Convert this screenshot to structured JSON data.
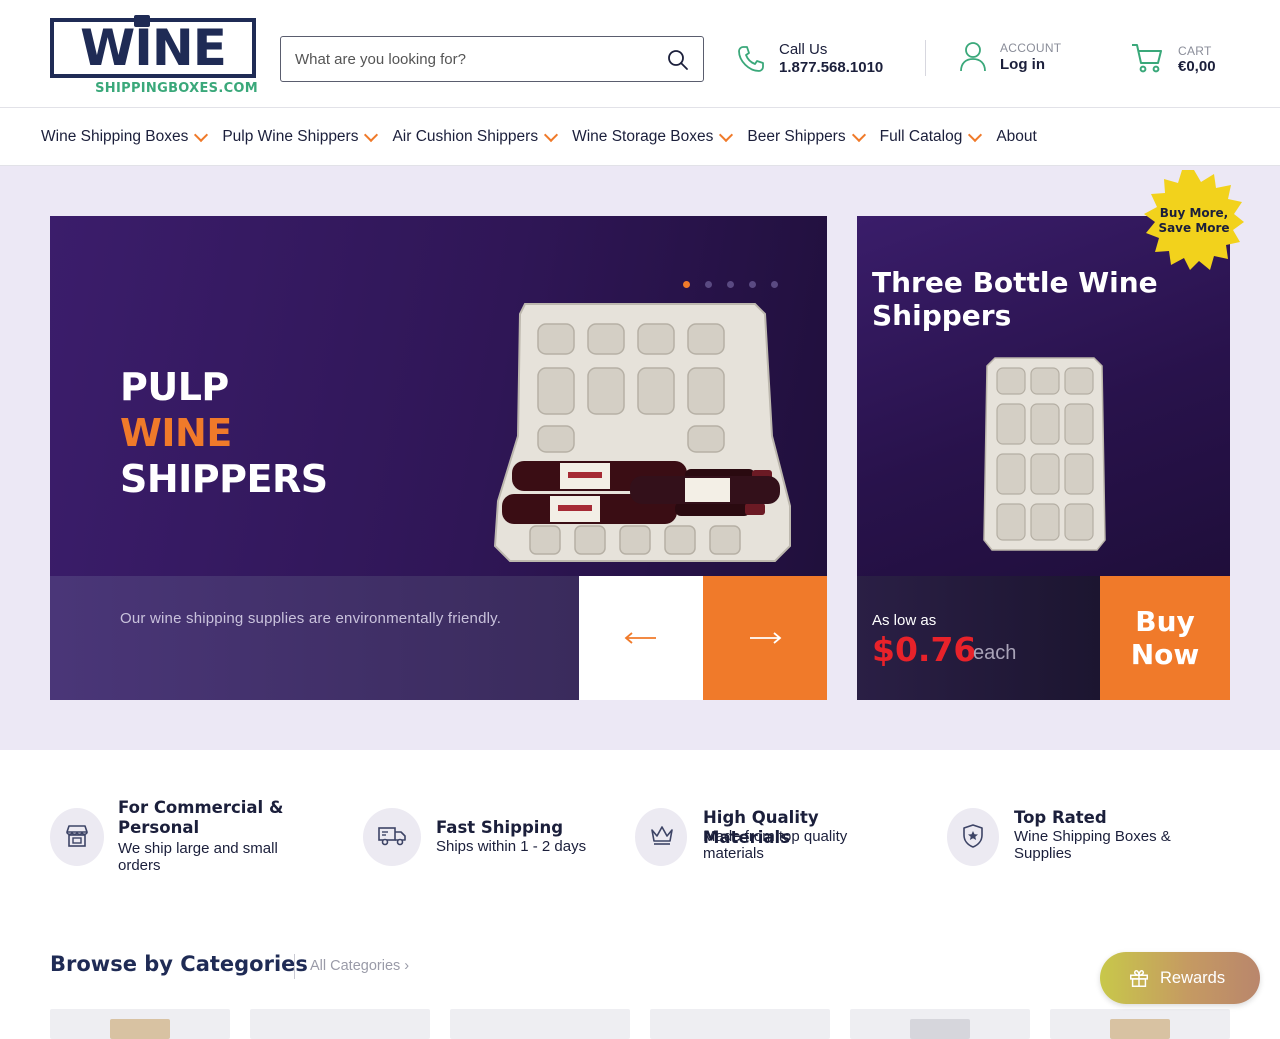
{
  "brand": {
    "logo_word": "WINE",
    "logo_sub": "SHIPPINGBOXES.COM"
  },
  "search": {
    "placeholder": "What are you looking for?",
    "value": ""
  },
  "contact": {
    "label": "Call Us",
    "phone": "1.877.568.1010"
  },
  "account": {
    "label": "ACCOUNT",
    "action": "Log in"
  },
  "cart": {
    "label": "CART",
    "total": "€0,00"
  },
  "nav": {
    "items": [
      {
        "label": "Wine Shipping Boxes",
        "dropdown": true
      },
      {
        "label": "Pulp Wine Shippers",
        "dropdown": true
      },
      {
        "label": "Air Cushion Shippers",
        "dropdown": true
      },
      {
        "label": "Wine Storage Boxes",
        "dropdown": true
      },
      {
        "label": "Beer Shippers",
        "dropdown": true
      },
      {
        "label": "Full Catalog",
        "dropdown": true
      },
      {
        "label": "About",
        "dropdown": false
      }
    ]
  },
  "hero": {
    "slide": {
      "line1": "PULP",
      "line2": "WINE",
      "line3": "SHIPPERS",
      "caption": "Our wine shipping supplies are environmentally friendly.",
      "slide_count": 5,
      "active_slide": 1
    },
    "promo": {
      "title": "Three Bottle Wine Shippers",
      "badge": "Buy More, Save More",
      "as_low_as": "As low as",
      "price": "$0.76",
      "unit": "each",
      "cta": "Buy Now"
    }
  },
  "features": [
    {
      "icon": "store-icon",
      "title": "For Commercial & Personal",
      "desc": "We ship large and small orders"
    },
    {
      "icon": "truck-icon",
      "title": "Fast Shipping",
      "desc": "Ships within 1 - 2 days"
    },
    {
      "icon": "crown-icon",
      "title": "High Quality Materials",
      "desc": "Made from top quality materials"
    },
    {
      "icon": "shield-star-icon",
      "title": "Top Rated",
      "desc": "Wine Shipping Boxes & Supplies"
    }
  ],
  "categories": {
    "title": "Browse by Categories",
    "all_link": "All Categories ›"
  },
  "rewards": {
    "label": "Rewards"
  },
  "colors": {
    "navy": "#1f2b55",
    "orange": "#f07a2a",
    "green": "#3aa87a",
    "price_red": "#e8222a",
    "hero_bg": "#ece8f5"
  }
}
